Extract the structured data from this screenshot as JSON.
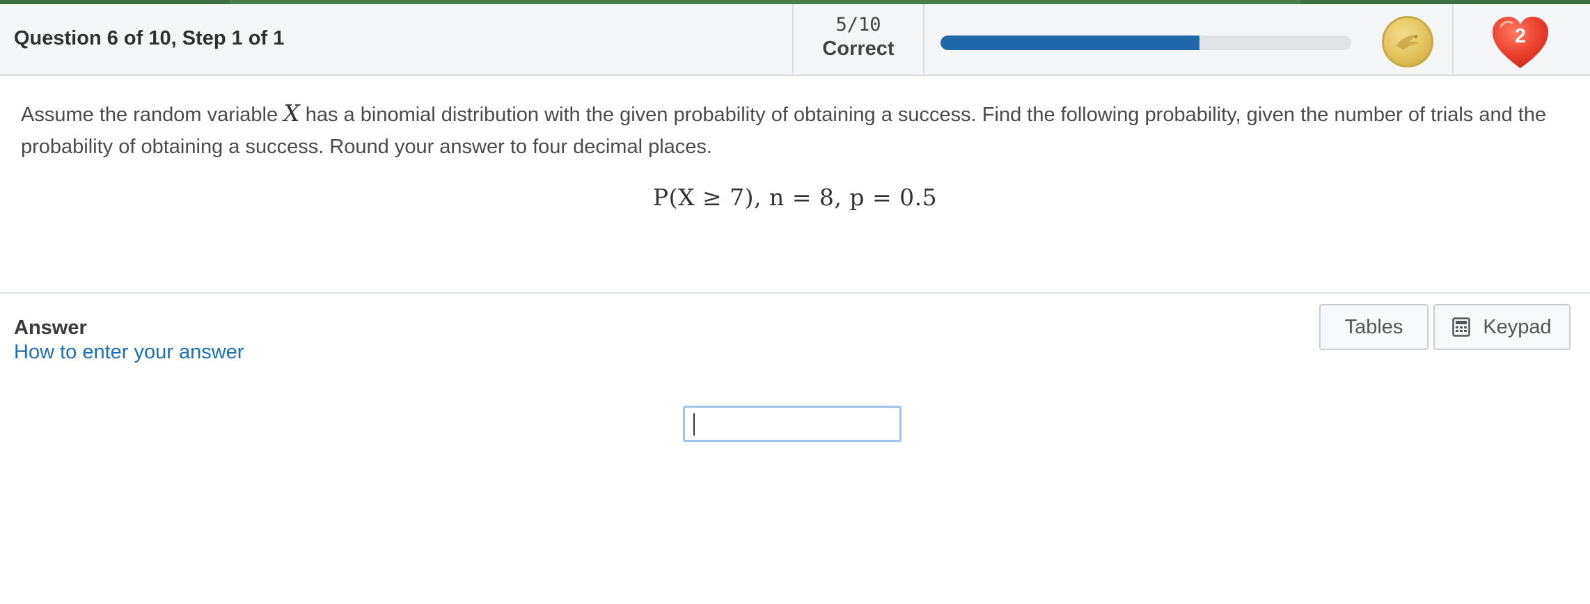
{
  "header": {
    "question_title": "Question 6 of 10, Step 1 of 1",
    "score": "5/10",
    "score_label": "Correct",
    "progress_fraction": 0.63,
    "progress_color": "#1e67a8",
    "coin_icon": "eagle-coin-icon",
    "hearts_count": "2",
    "heart_color": "#e8402e"
  },
  "question": {
    "text_before_var": "Assume the random variable ",
    "variable": "X",
    "text_after_var": " has a binomial distribution with the given probability of obtaining a success. Find the following probability, given the number of trials and the probability of obtaining a success. Round your answer to four decimal places.",
    "formula": "P(X ≥ 7), n = 8, p = 0.5"
  },
  "answer": {
    "label": "Answer",
    "help_link": "How to enter your answer",
    "input_value": "",
    "tables_button": "Tables",
    "keypad_button": "Keypad",
    "keypad_icon": "calculator-icon"
  }
}
